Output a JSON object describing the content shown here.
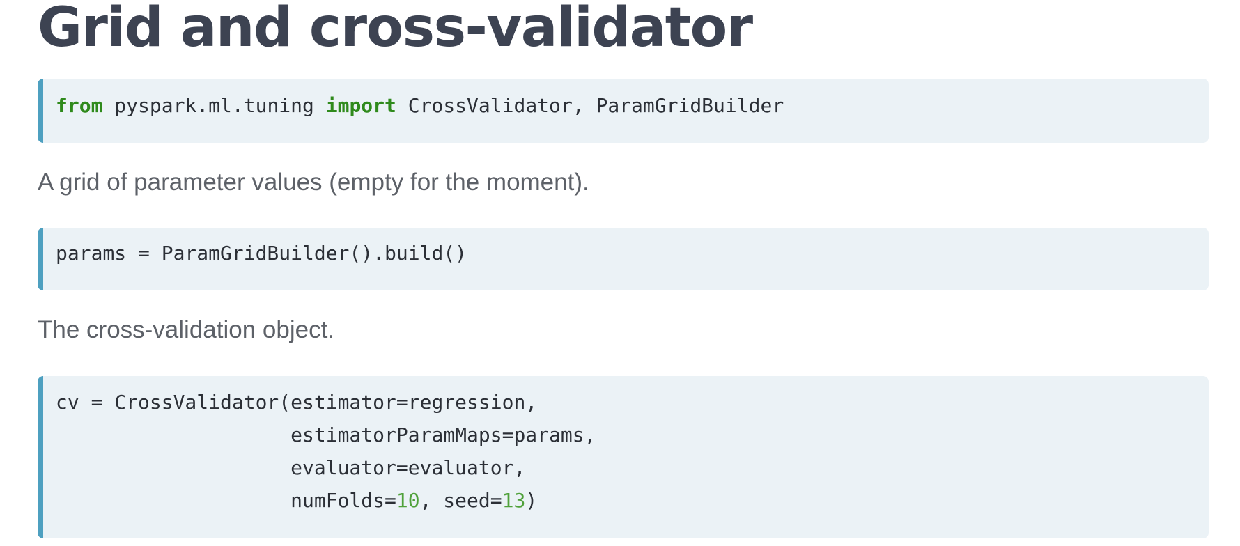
{
  "heading": "Grid and cross-validator",
  "code1": {
    "line1": {
      "kw_from": "from",
      "module": " pyspark.ml.tuning ",
      "kw_import": "import",
      "names": " CrossValidator, ParamGridBuilder"
    }
  },
  "para1": "A grid of parameter values (empty for the moment).",
  "code2": {
    "line1": "params = ParamGridBuilder().build()"
  },
  "para2": "The cross-validation object.",
  "code3": {
    "line1": "cv = CrossValidator(estimator=regression,",
    "line2": "                    estimatorParamMaps=params,",
    "line3": "                    evaluator=evaluator,",
    "line4_a": "                    numFolds=",
    "line4_num1": "10",
    "line4_b": ", seed=",
    "line4_num2": "13",
    "line4_c": ")"
  },
  "colors": {
    "heading": "#3d4352",
    "code_background": "#ebf2f6",
    "code_border": "#4ea0c0",
    "keyword": "#2f8a1c",
    "number": "#4fa13a",
    "paragraph": "#5d6168"
  }
}
